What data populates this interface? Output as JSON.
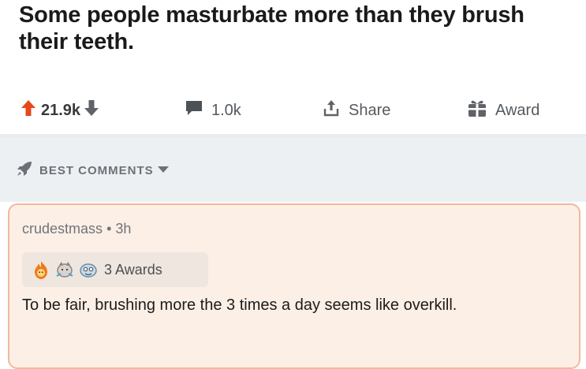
{
  "post": {
    "title": "Some people masturbate more than they brush their teeth."
  },
  "actions": {
    "upvotes": "21.9k",
    "comments": "1.0k",
    "share_label": "Share",
    "award_label": "Award"
  },
  "sort": {
    "label": "BEST COMMENTS"
  },
  "comment": {
    "author": "crudestmass",
    "separator": "•",
    "age": "3h",
    "awards_count": "3 Awards",
    "body": "To be fair, brushing more the 3 times a day seems like overkill."
  },
  "colors": {
    "upvote": "#e8471c",
    "muted": "#555a5f",
    "highlight_bg": "#fcefe6",
    "highlight_border": "#f3b89c"
  },
  "icons": {
    "upvote": "up-arrow-icon",
    "downvote": "down-arrow-icon",
    "comments": "comment-bubble-icon",
    "share": "share-icon",
    "award": "gift-icon",
    "sort": "rocket-icon",
    "sort_dropdown": "caret-down-icon"
  }
}
